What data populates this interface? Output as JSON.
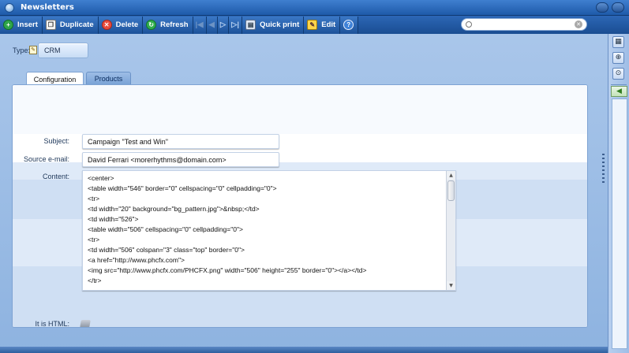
{
  "window": {
    "title": "Newsletters"
  },
  "toolbar": {
    "insert": "Insert",
    "duplicate": "Duplicate",
    "delete": "Delete",
    "refresh": "Refresh",
    "quick_print": "Quick print",
    "edit": "Edit",
    "icons": [
      "insert-icon",
      "duplicate-icon",
      "delete-icon",
      "refresh-icon",
      "first-record-icon",
      "previous-record-icon",
      "next-record-icon",
      "last-record-icon",
      "quick-print-icon",
      "edit-icon",
      "help-icon"
    ]
  },
  "search": {
    "value": "",
    "placeholder": ""
  },
  "form": {
    "type_label": "Type:",
    "type_value": "CRM",
    "tabs": [
      {
        "label": "Configuration",
        "active": true
      },
      {
        "label": "Products",
        "active": false
      }
    ],
    "subject_label": "Subject:",
    "subject_value": "Campaign \"Test and Win\"",
    "source_email_label": "Source e-mail:",
    "source_email_value": "David Ferrari <morerhythms@domain.com>",
    "content_label": "Content:",
    "content_lines": [
      "<center>",
      "<table width=\"546\" border=\"0\" cellspacing=\"0\" cellpadding=\"0\">",
      "<tr>",
      "<td width=\"20\" background=\"bg_pattern.jpg\">&nbsp;</td>",
      "<td width=\"526\">",
      "<table width=\"506\" cellspacing=\"0\" cellpadding=\"0\">",
      "<tr>",
      "<td width=\"506\" colspan=\"3\" class=\"top\" border=\"0\">",
      "<a href=\"http://www.phcfx.com\">",
      "<img src=\"http://www.phcfx.com/PHCFX.png\" width=\"506\" height=\"255\" border=\"0\"></a></td>",
      "</tr>"
    ],
    "is_html_label": "It is HTML:",
    "is_html_checked": true
  },
  "colors": {
    "toolbar": "#1d5299",
    "background": "#9fbfe8",
    "panel": "#ffffff"
  }
}
